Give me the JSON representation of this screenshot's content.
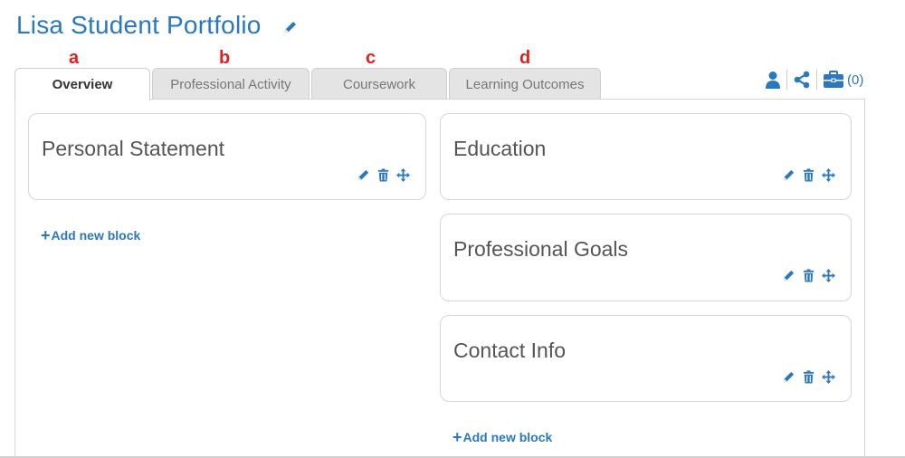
{
  "page": {
    "title": "Lisa Student Portfolio"
  },
  "annotations": [
    "a",
    "b",
    "c",
    "d"
  ],
  "tabs": [
    {
      "label": "Overview",
      "active": true
    },
    {
      "label": "Professional Activity",
      "active": false
    },
    {
      "label": "Coursework",
      "active": false
    },
    {
      "label": "Learning Outcomes",
      "active": false
    }
  ],
  "toolbar": {
    "icons": [
      "user-icon",
      "share-icon",
      "briefcase-icon"
    ],
    "briefcase_count": "(0)"
  },
  "left_column": {
    "blocks": [
      {
        "title": "Personal Statement"
      }
    ],
    "add_label": "Add new block"
  },
  "right_column": {
    "blocks": [
      {
        "title": "Education"
      },
      {
        "title": "Professional Goals"
      },
      {
        "title": "Contact Info"
      }
    ],
    "add_label": "Add new block"
  },
  "block_actions": [
    "pencil-icon",
    "trash-icon",
    "move-icon"
  ],
  "colors": {
    "accent": "#2a78be",
    "annotation": "#e02020",
    "tab_inactive_bg": "#e4e4e4",
    "border": "#d6d6d6"
  }
}
